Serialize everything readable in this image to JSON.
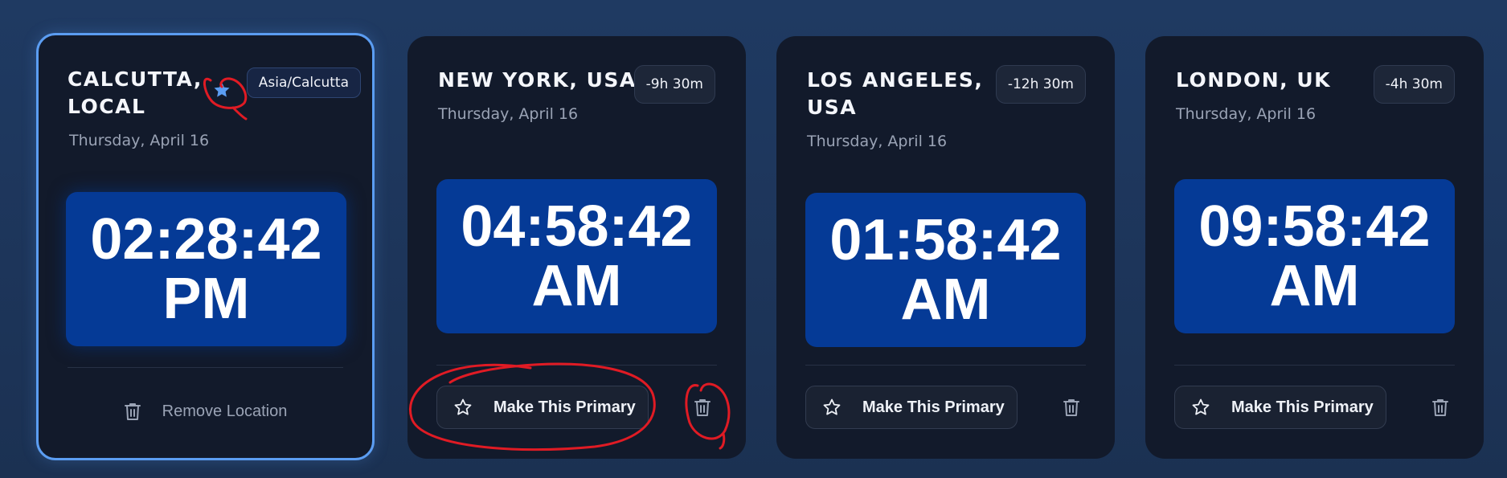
{
  "cards": [
    {
      "city_line1": "CALCUTTA,",
      "city_line2": "LOCAL",
      "badge": "Asia/Calcutta",
      "date": "Thursday, April 16",
      "time": "02:28:42",
      "period": "PM",
      "action_label": "Remove Location",
      "primary": true,
      "icon": "star-filled-icon"
    },
    {
      "city_line1": "NEW YORK, USA",
      "city_line2": "",
      "badge": "-9h 30m",
      "date": "Thursday, April 16",
      "time": "04:58:42",
      "period": "AM",
      "action_label": "Make This Primary"
    },
    {
      "city_line1": "LOS ANGELES,",
      "city_line2": "USA",
      "badge": "-12h 30m",
      "date": "Thursday, April 16",
      "time": "01:58:42",
      "period": "AM",
      "action_label": "Make This Primary"
    },
    {
      "city_line1": "LONDON, UK",
      "city_line2": "",
      "badge": "-4h 30m",
      "date": "Thursday, April 16",
      "time": "09:58:42",
      "period": "AM",
      "action_label": "Make This Primary"
    }
  ],
  "colors": {
    "background": "#1e3760",
    "card": "#121a2b",
    "clock_bg": "#053a96",
    "primary_border": "#5b9df2",
    "annotation": "#e01b24"
  }
}
